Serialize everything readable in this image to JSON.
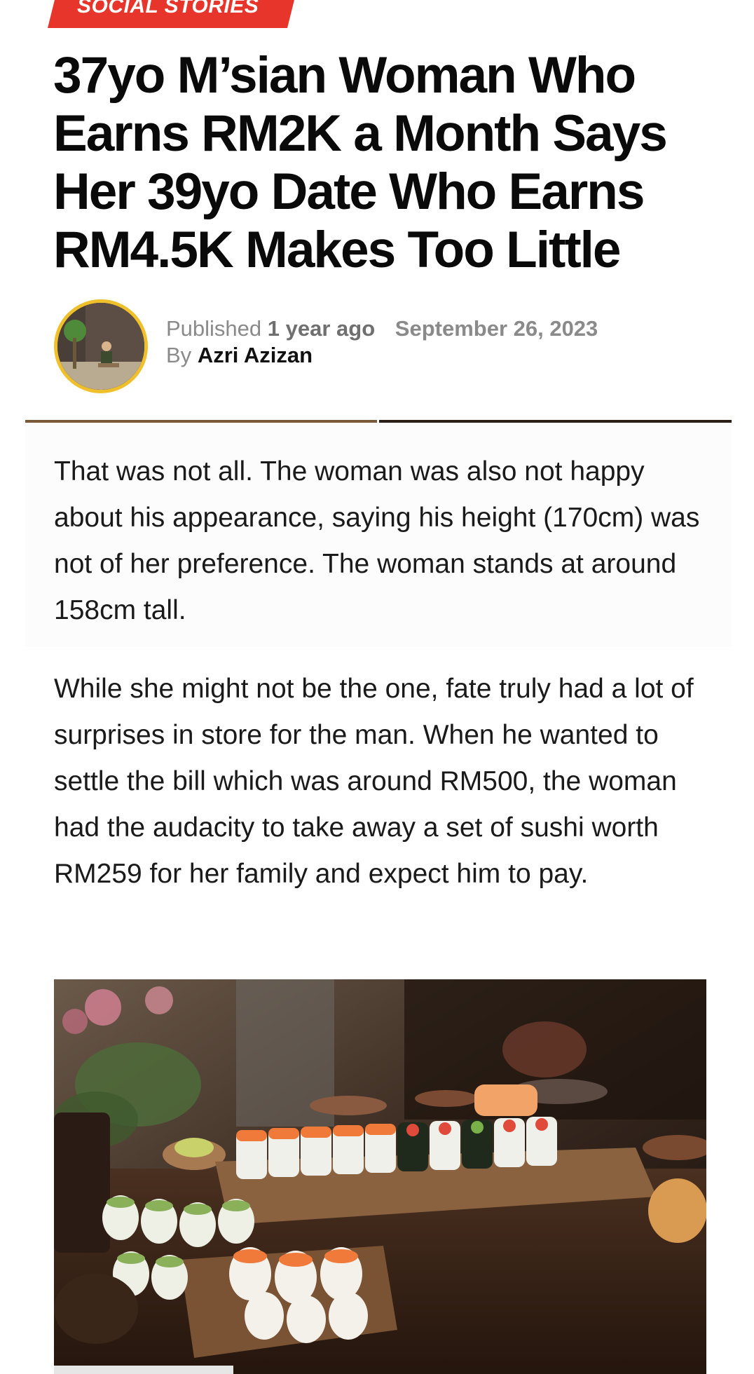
{
  "article": {
    "category": "SOCIAL STORIES",
    "headline": "37yo M’sian Woman Who Earns RM2K a Month Says Her 39yo Date Who Earns RM4.5K Makes Too Little",
    "published_label": "Published",
    "published_relative": "1 year ago",
    "published_date": "September 26, 2023",
    "by_label": "By",
    "author": "Azri Azizan",
    "paragraphs": [
      "That was not all. The woman was also not happy about his appearance, saying his height (170cm) was not of her preference. The woman stands at around 158cm tall.",
      "While she might not be the one, fate truly had a lot of surprises in store for the man. When he wanted to settle the bill which was around RM500, the woman had the audacity to take away a set of sushi worth RM259 for her family and expect him to pay."
    ]
  },
  "colors": {
    "category_bg": "#e8352b",
    "avatar_ring": "#f0c02c",
    "text": "#111111",
    "meta_text": "#8a8a8a"
  },
  "icons": {
    "avatar": "author-avatar-photo",
    "image": "sushi-photo"
  }
}
